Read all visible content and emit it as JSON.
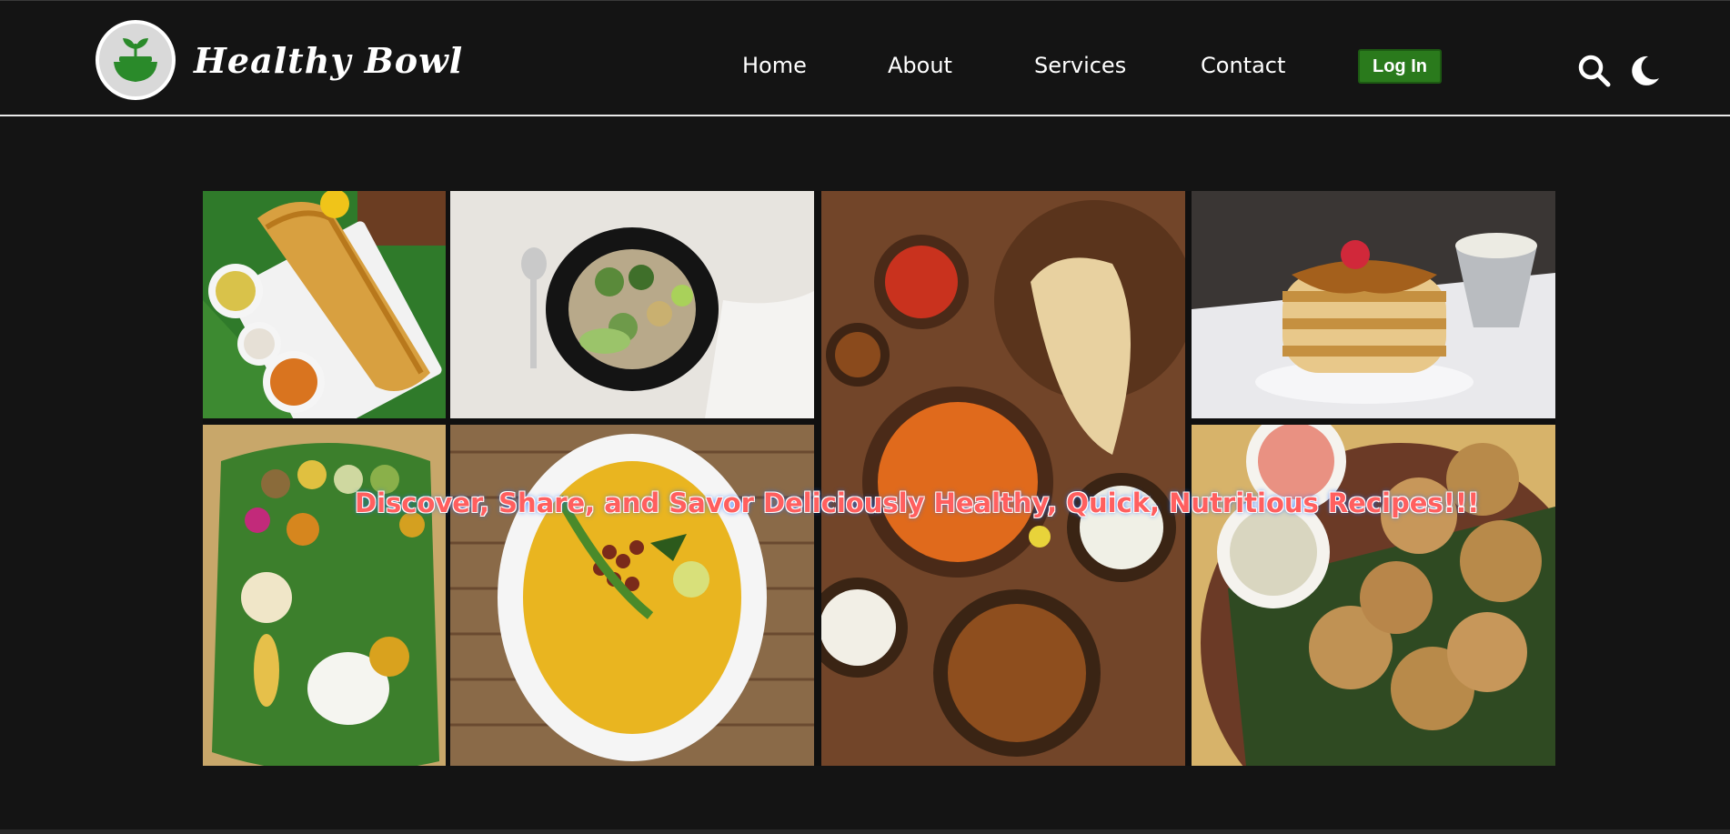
{
  "brand": {
    "name": "Healthy Bowl",
    "logo_icon": "leaf-bowl-icon",
    "accent": "#2a7a1c"
  },
  "nav": {
    "items": [
      {
        "label": "Home"
      },
      {
        "label": "About"
      },
      {
        "label": "Services"
      },
      {
        "label": "Contact"
      }
    ],
    "login_label": "Log In",
    "search_icon": "search-icon",
    "theme_icon": "moon-icon"
  },
  "hero": {
    "tagline": "Discover, Share, and Savor Deliciously Healthy, Quick, Nutritious Recipes!!!",
    "tagline_color": "#ff5f5f"
  },
  "gallery": {
    "images": [
      {
        "name": "dosa-image"
      },
      {
        "name": "salad-bowl-image"
      },
      {
        "name": "indian-curry-spread-image"
      },
      {
        "name": "pancakes-image"
      },
      {
        "name": "sadya-meal-image"
      },
      {
        "name": "poha-image"
      },
      {
        "name": "paniyaram-image"
      }
    ]
  },
  "colors": {
    "background": "#141414",
    "header_rule": "#e9e9e9"
  }
}
